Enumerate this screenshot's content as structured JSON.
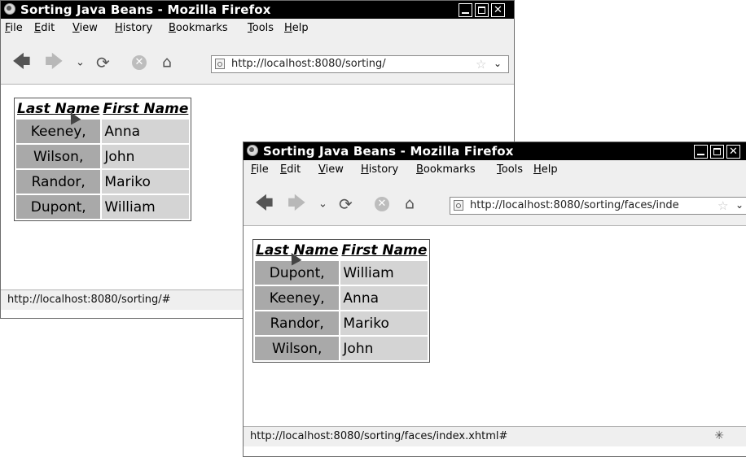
{
  "window_back": {
    "title": "Sorting Java Beans - Mozilla Firefox",
    "menu": [
      "File",
      "Edit",
      "View",
      "History",
      "Bookmarks",
      "Tools",
      "Help"
    ],
    "url": "http://localhost:8080/sorting/",
    "table": {
      "headers": [
        "Last Name",
        "First Name"
      ],
      "rows": [
        [
          "Keeney,",
          "Anna"
        ],
        [
          "Wilson,",
          "John"
        ],
        [
          "Randor,",
          "Mariko"
        ],
        [
          "Dupont,",
          "William"
        ]
      ]
    },
    "status": "http://localhost:8080/sorting/#"
  },
  "window_front": {
    "title": "Sorting Java Beans - Mozilla Firefox",
    "menu": [
      "File",
      "Edit",
      "View",
      "History",
      "Bookmarks",
      "Tools",
      "Help"
    ],
    "url": "http://localhost:8080/sorting/faces/inde",
    "table": {
      "headers": [
        "Last Name",
        "First Name"
      ],
      "rows": [
        [
          "Dupont,",
          "William"
        ],
        [
          "Keeney,",
          "Anna"
        ],
        [
          "Randor,",
          "Mariko"
        ],
        [
          "Wilson,",
          "John"
        ]
      ]
    },
    "status": "http://localhost:8080/sorting/faces/index.xhtml#"
  },
  "icons": {
    "back": "back-arrow-icon",
    "forward": "forward-arrow-icon",
    "history_dropdown": "chevron-down-icon",
    "reload": "reload-icon",
    "stop": "stop-icon",
    "home": "home-icon",
    "bookmark": "star-icon"
  },
  "colors": {
    "titlebar": "#000000",
    "chrome": "#efefef",
    "last_name_cell": "#a9a9a9",
    "first_name_cell": "#d4d4d4"
  }
}
